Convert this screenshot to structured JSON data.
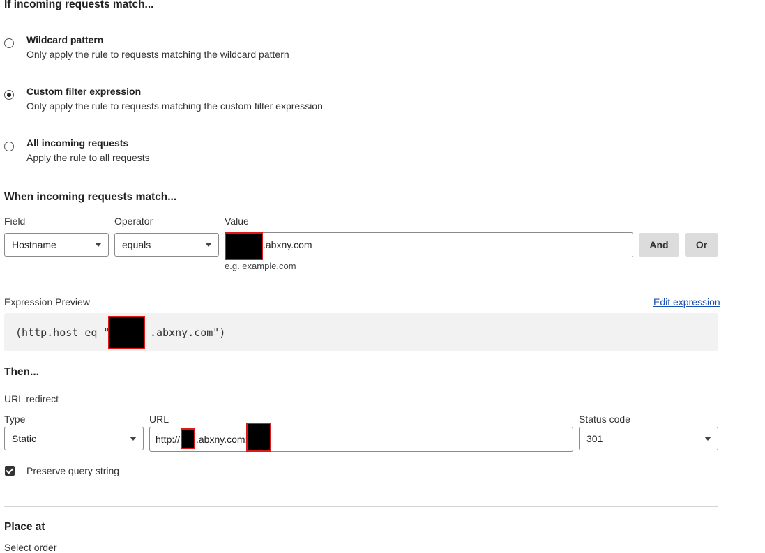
{
  "section_match": {
    "title": "If incoming requests match..."
  },
  "options": [
    {
      "title": "Wildcard pattern",
      "desc": "Only apply the rule to requests matching the wildcard pattern",
      "checked": false
    },
    {
      "title": "Custom filter expression",
      "desc": "Only apply the rule to requests matching the custom filter expression",
      "checked": true
    },
    {
      "title": "All incoming requests",
      "desc": "Apply the rule to all requests",
      "checked": false
    }
  ],
  "section_when": {
    "title": "When incoming requests match..."
  },
  "filter": {
    "field_label": "Field",
    "field_value": "Hostname",
    "operator_label": "Operator",
    "operator_value": "equals",
    "value_label": "Value",
    "value_text": ".abxny.com",
    "value_hint": "e.g. example.com",
    "and_label": "And",
    "or_label": "Or"
  },
  "expression": {
    "label": "Expression Preview",
    "edit_link": "Edit expression",
    "prefix": "(http.host eq \"",
    "suffix": ".abxny.com\")"
  },
  "then": {
    "title": "Then...",
    "action": "URL redirect",
    "type_label": "Type",
    "type_value": "Static",
    "url_label": "URL",
    "url_prefix": "http://",
    "url_middle": ".abxny.com:",
    "status_label": "Status code",
    "status_value": "301",
    "preserve_label": "Preserve query string",
    "preserve_checked": true
  },
  "place": {
    "title": "Place at",
    "select_label": "Select order"
  }
}
